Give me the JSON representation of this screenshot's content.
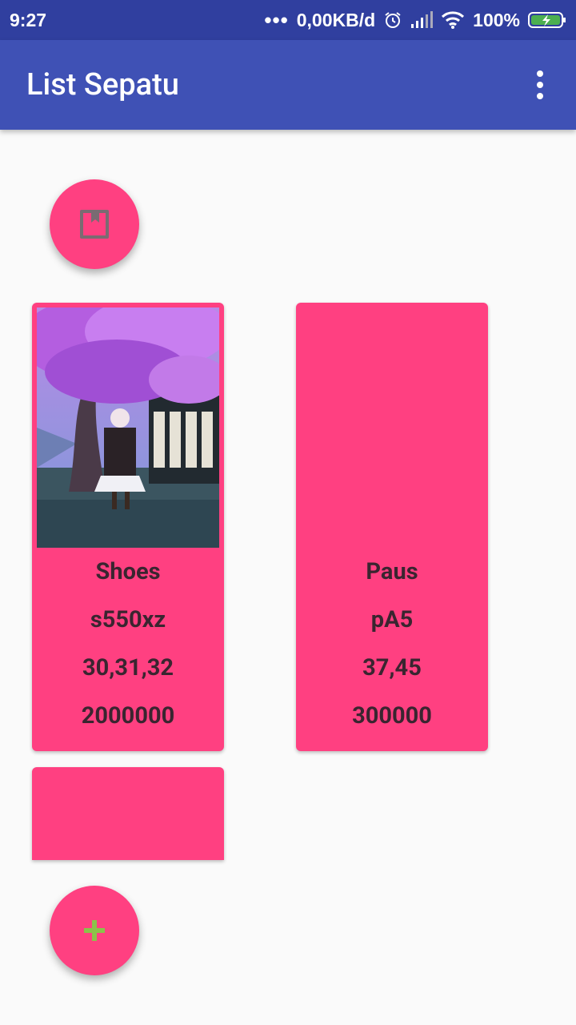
{
  "status_bar": {
    "time": "9:27",
    "dots": "•••",
    "net_speed": "0,00KB/d",
    "battery": "100%"
  },
  "app_bar": {
    "title": "List Sepatu"
  },
  "icons": {
    "top_fab": "book-icon",
    "add_fab": "plus-icon",
    "menu": "more-vert-icon"
  },
  "colors": {
    "status_bar": "#303f9f",
    "app_bar": "#3f51b5",
    "accent": "#ff4081",
    "card_text": "#3a2530",
    "add_icon": "#8bc34a"
  },
  "shoes": [
    {
      "name": "Shoes",
      "code": "s550xz",
      "sizes": "30,31,32",
      "price": "2000000"
    },
    {
      "name": "Paus",
      "code": "pA5",
      "sizes": "37,45",
      "price": "300000"
    }
  ]
}
